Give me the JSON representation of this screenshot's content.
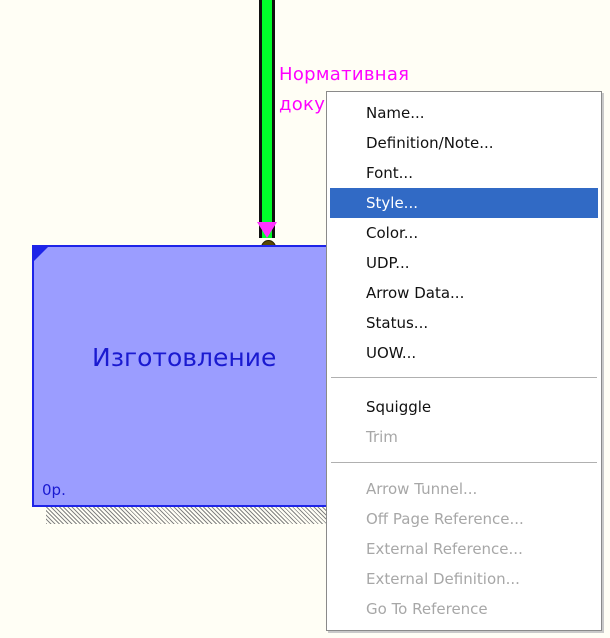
{
  "diagram": {
    "arrow_label_line1": "Нормативная",
    "arrow_label_line2": "доку",
    "activity_title": "Изготовление",
    "activity_cost": "0р."
  },
  "context_menu": {
    "items": [
      {
        "label": "Name...",
        "enabled": true
      },
      {
        "label": "Definition/Note...",
        "enabled": true
      },
      {
        "label": "Font...",
        "enabled": true
      },
      {
        "label": "Style...",
        "enabled": true,
        "selected": true
      },
      {
        "label": "Color...",
        "enabled": true
      },
      {
        "label": "UDP...",
        "enabled": true
      },
      {
        "label": "Arrow Data...",
        "enabled": true
      },
      {
        "label": "Status...",
        "enabled": true
      },
      {
        "label": "UOW...",
        "enabled": true
      },
      {
        "label": "Squiggle",
        "enabled": true
      },
      {
        "label": "Trim",
        "enabled": false
      },
      {
        "label": "Arrow Tunnel...",
        "enabled": false
      },
      {
        "label": "Off Page Reference...",
        "enabled": false
      },
      {
        "label": "External Reference...",
        "enabled": false
      },
      {
        "label": "External Definition...",
        "enabled": false
      },
      {
        "label": "Go To Reference",
        "enabled": false
      }
    ]
  },
  "colors": {
    "arrow": "#00ff2a",
    "arrow_label": "#ff00ff",
    "activity_fill": "#9b9dff",
    "activity_border": "#1e24e8",
    "menu_highlight": "#316ac5"
  }
}
